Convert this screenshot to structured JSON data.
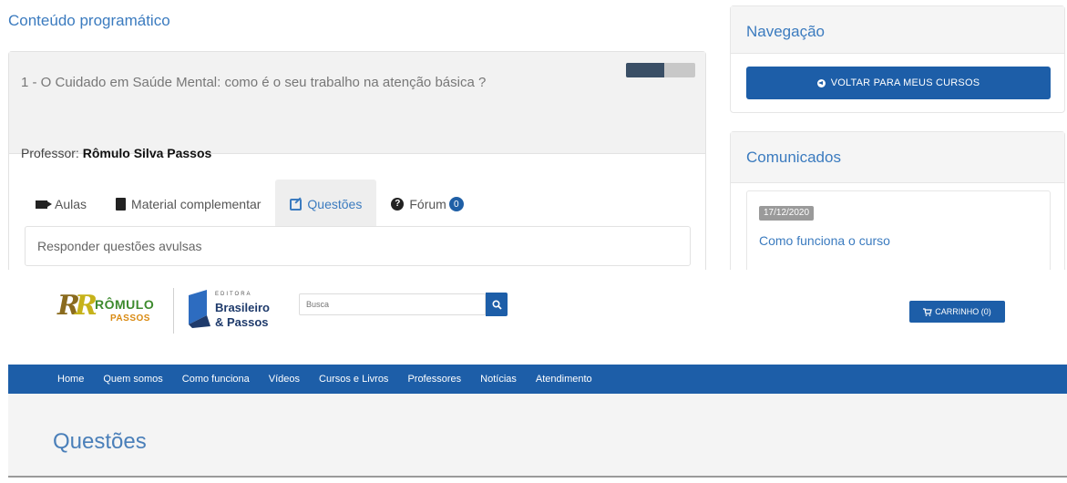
{
  "course": {
    "section_title": "Conteúdo programático",
    "module_title": "1 - O Cuidado em Saúde Mental: como é o seu trabalho na atenção básica ?",
    "progress": 0.55,
    "teacher_label": "Professor:",
    "teacher_name": "Rômulo Silva Passos",
    "tabs": [
      {
        "label": "Aulas",
        "icon": "video-camera-icon"
      },
      {
        "label": "Material complementar",
        "icon": "book-icon"
      },
      {
        "label": "Questões",
        "icon": "edit-icon",
        "active": true
      },
      {
        "label": "Fórum",
        "icon": "question-circle-icon",
        "badge": "0"
      }
    ],
    "answer_text": "Responder questões avulsas"
  },
  "sidebar": {
    "nav_title": "Navegação",
    "back_button": "VOLTAR PARA MEUS CURSOS",
    "notices_title": "Comunicados",
    "notice": {
      "date": "17/12/2020",
      "link": "Como funciona o curso"
    }
  },
  "site": {
    "logo1_line1": "RÔMULO",
    "logo1_line2": "PASSOS",
    "logo2_small": "EDITORA",
    "logo2_line1": "Brasileiro",
    "logo2_line2": "& Passos",
    "search_placeholder": "Busca",
    "cart_label": "CARRINHO (0)",
    "nav_items": [
      "Home",
      "Quem somos",
      "Como funciona",
      "Vídeos",
      "Cursos e Livros",
      "Professores",
      "Notícias",
      "Atendimento"
    ],
    "page_title": "Questões"
  },
  "colors": {
    "primary": "#1d5ea8",
    "link": "#3b7bbf",
    "date_badge": "#9a9a9a"
  }
}
